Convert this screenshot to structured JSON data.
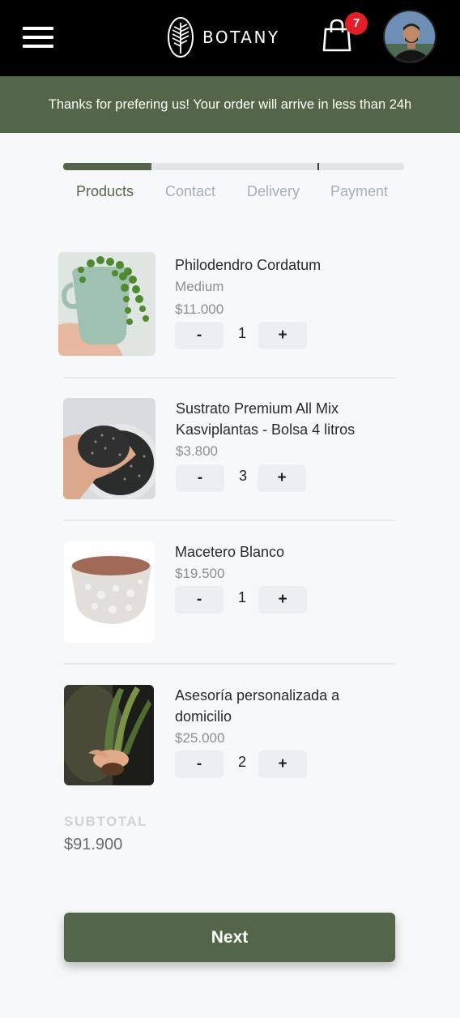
{
  "header": {
    "brand": "BOTANY",
    "cart_count": "7"
  },
  "banner": {
    "text": "Thanks for prefering us! Your order will arrive in less than 24h"
  },
  "checkout": {
    "progress_fraction": 0.26,
    "steps": [
      {
        "label": "Products",
        "active": true
      },
      {
        "label": "Contact",
        "active": false
      },
      {
        "label": "Delivery",
        "active": false
      },
      {
        "label": "Payment",
        "active": false
      }
    ]
  },
  "cart": {
    "items": [
      {
        "name": "Philodendro Cordatum",
        "variant": "Medium",
        "price": "$11.000",
        "quantity": "1",
        "minus": "-",
        "plus": "+"
      },
      {
        "name": "Sustrato Premium All Mix Kasviplantas - Bolsa 4 litros",
        "price": "$3.800",
        "quantity": "3",
        "minus": "-",
        "plus": "+"
      },
      {
        "name": "Macetero Blanco",
        "price": "$19.500",
        "quantity": "1",
        "minus": "-",
        "plus": "+"
      },
      {
        "name": "Asesoría personalizada a domicilio",
        "price": "$25.000",
        "quantity": "2",
        "minus": "-",
        "plus": "+"
      }
    ],
    "subtotal_label": "SUBTOTAL",
    "subtotal_value": "$91.900"
  },
  "actions": {
    "next_label": "Next"
  },
  "colors": {
    "brand_green": "#546649",
    "badge_red": "#e01f26",
    "header_bg": "#000000"
  }
}
